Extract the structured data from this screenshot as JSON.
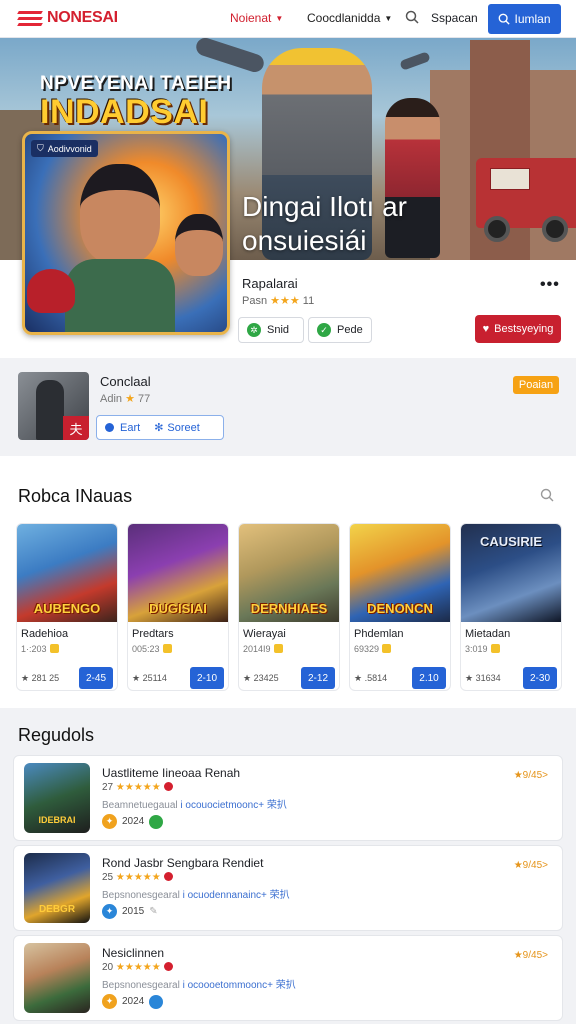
{
  "header": {
    "logo": "NONESAI",
    "nav_1": "Noienat",
    "nav_2": "Coocdlanidda",
    "search_label": "Sspacan",
    "signin_label": "Iumlan"
  },
  "hero": {
    "title_line1": "NPVEYENAI ТАЕІЕН",
    "title_line2": "INDADSAI",
    "caption_line1": "Dingai Ilotı ar",
    "caption_line2": "onsuiesiái"
  },
  "app": {
    "cover_badge": "Aodivvonid",
    "name": "Rapalarai",
    "meta_prefix": "Pasn",
    "stars": "★★★",
    "meta_count": "11",
    "more": "•••",
    "chip_1": "Snid",
    "chip_2": "Pede",
    "wishlist": "Bestsyeying"
  },
  "related": {
    "title": "Conclaal",
    "meta_prefix": "Adin",
    "star": "★",
    "meta_value": "77",
    "thumb_badge": "夫",
    "action_1": "Eart",
    "action_2": "Soreet",
    "tag": "Poaian"
  },
  "popular": {
    "title": "Robca INauas",
    "cards": [
      {
        "art": "AUBENGO",
        "name": "Radehioa",
        "sub": "1·:203",
        "rating": "★ 281 25",
        "price": "2-45"
      },
      {
        "art": "DUGISIAI",
        "name": "Predtars",
        "sub": "005:23",
        "rating": "★ 25114",
        "price": "2-10"
      },
      {
        "art": "DERNHIAES",
        "name": "Wierayai",
        "sub": "2014I9",
        "rating": "★ 23425",
        "price": "2-12"
      },
      {
        "art": "DENONCN",
        "name": "Phdemlan",
        "sub": "69329",
        "rating": "★ .5814",
        "price": "2.10"
      },
      {
        "art": "CAUSIRIE",
        "name": "Mietadan",
        "sub": "3:019",
        "rating": "★ 31634",
        "price": "2-30"
      }
    ]
  },
  "regulars": {
    "title": "Regudols",
    "items": [
      {
        "title": "Uastliteme Iineoaa Renah",
        "meta_num": "27",
        "stars": "★★★★★",
        "desc_a": "Beamnetuegaual",
        "desc_b": " i ocouocietmoonc+ 荣扒",
        "foot": "2024",
        "rating": "★9/45>",
        "art": "IDEBRAI"
      },
      {
        "title": "Rond Jasbr Sengbara Rendiet",
        "meta_num": "25",
        "stars": "★★★★★",
        "desc_a": "Bepsnonesgearal",
        "desc_b": " i ocuodennanainc+ 荣扒",
        "foot": "2015",
        "rating": "★9/45>",
        "art": "DEBGR"
      },
      {
        "title": "Nesiclinnen",
        "meta_num": "20",
        "stars": "★★★★★",
        "desc_a": "Bepsnonesgearal",
        "desc_b": " i ocoooetommoonc+ 荣扒",
        "foot": "2024",
        "rating": "★9/45>",
        "art": ""
      }
    ]
  },
  "colors": {
    "brand_red": "#d4202f",
    "primary_blue": "#2563d6",
    "star": "#f3a51c",
    "tag_orange": "#f6a214"
  }
}
